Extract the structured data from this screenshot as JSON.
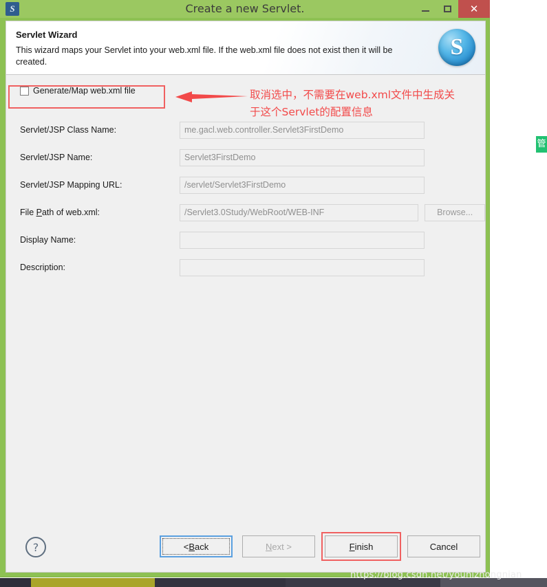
{
  "window": {
    "title": "Create a new Servlet.",
    "app_icon": "servlet-app-icon",
    "controls": {
      "minimize": "minimize-icon",
      "maximize": "maximize-icon",
      "close": "✕"
    },
    "chrome_color": "#8dc153",
    "close_color": "#c0504d"
  },
  "wizard": {
    "title": "Servlet Wizard",
    "description": "This wizard maps your Servlet into your web.xml file. If the web.xml file does not exist then it will be created.",
    "logo_letter": "S"
  },
  "form": {
    "checkbox": {
      "label": "Generate/Map web.xml file",
      "checked": false
    },
    "fields": [
      {
        "label": "Servlet/JSP Class Name:",
        "value": "me.gacl.web.controller.Servlet3FirstDemo",
        "has_browse": false
      },
      {
        "label": "Servlet/JSP Name:",
        "value": "Servlet3FirstDemo",
        "has_browse": false
      },
      {
        "label": "Servlet/JSP Mapping URL:",
        "value": "/servlet/Servlet3FirstDemo",
        "has_browse": false
      },
      {
        "label_pre": "File ",
        "label_mnemonic": "P",
        "label_post": "ath of web.xml:",
        "label": "File Path of web.xml:",
        "value": "/Servlet3.0Study/WebRoot/WEB-INF",
        "has_browse": true,
        "browse_label": "Browse..."
      },
      {
        "label": "Display Name:",
        "value": "",
        "has_browse": false
      },
      {
        "label": "Description:",
        "value": "",
        "has_browse": false
      }
    ]
  },
  "annotation": {
    "text": "取消选中，不需要在web.xml文件中生成关\n于这个Servlet的配置信息",
    "color": "#f24a4a",
    "arrow": "left-arrow-icon"
  },
  "buttons": {
    "help": "?",
    "back": {
      "pre": "< ",
      "mnemonic": "B",
      "post": "ack",
      "label": "< Back",
      "state": "focused"
    },
    "next": {
      "pre": "",
      "mnemonic": "N",
      "post": "ext >",
      "label": "Next >",
      "state": "disabled"
    },
    "finish": {
      "pre": "",
      "mnemonic": "F",
      "post": "inish",
      "label": "Finish",
      "state": "highlighted"
    },
    "cancel": {
      "label": "Cancel",
      "state": "normal"
    }
  },
  "watermark": "https://blog.csdn.net/younizhongnian",
  "badge": {
    "text": "管"
  }
}
